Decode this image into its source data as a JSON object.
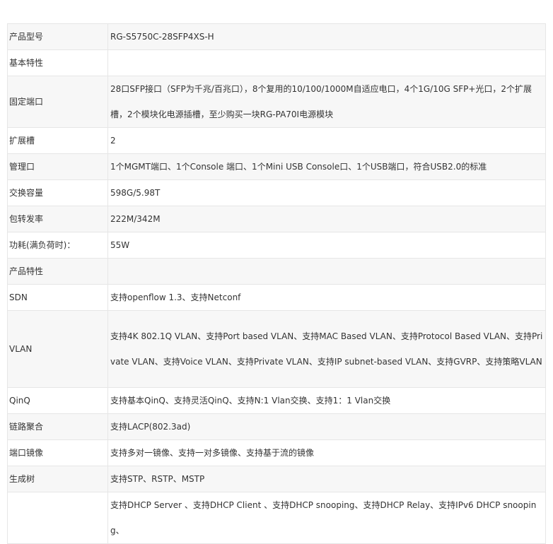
{
  "rows": [
    {
      "label": "产品型号",
      "value": "RG-S5750C-28SFP4XS-H"
    },
    {
      "label": "基本特性",
      "value": ""
    },
    {
      "label": "固定端口",
      "value": "28口SFP接口（SFP为千兆/百兆口），8个复用的10/100/1000M自适应电口，4个1G/10G SFP+光口，2个扩展槽，2个模块化电源插槽，至少购买一块RG-PA70I电源模块"
    },
    {
      "label": "扩展槽",
      "value": "2"
    },
    {
      "label": "管理口",
      "value": "1个MGMT端口、1个Console 端口、1个Mini USB Console口、1个USB端口，符合USB2.0的标准"
    },
    {
      "label": "交换容量",
      "value": "598G/5.98T"
    },
    {
      "label": "包转发率",
      "value": "222M/342M"
    },
    {
      "label": "功耗(满负荷时)：",
      "value": "55W"
    },
    {
      "label": "产品特性",
      "value": ""
    },
    {
      "label": "SDN",
      "value": "支持openflow 1.3、支持Netconf"
    },
    {
      "label": "VLAN",
      "value": "支持4K 802.1Q VLAN、支持Port based VLAN、支持MAC Based VLAN、支持Protocol Based VLAN、支持Private VLAN、支持Voice VLAN、支持Private VLAN、支持IP subnet-based VLAN、支持GVRP、支持策略VLAN"
    },
    {
      "label": "QinQ",
      "value": "支持基本QinQ、支持灵活QinQ、支持N:1 Vlan交换、支持1：1 Vlan交换"
    },
    {
      "label": "链路聚合",
      "value": "支持LACP(802.3ad)"
    },
    {
      "label": "端口镜像",
      "value": "支持多对一镜像、支持一对多镜像、支持基于流的镜像"
    },
    {
      "label": "生成树",
      "value": "支持STP、RSTP、MSTP"
    },
    {
      "label": "",
      "value": "支持DHCP Server 、支持DHCP Client 、支持DHCP snooping、支持DHCP Relay、支持IPv6 DHCP snooping、"
    }
  ]
}
